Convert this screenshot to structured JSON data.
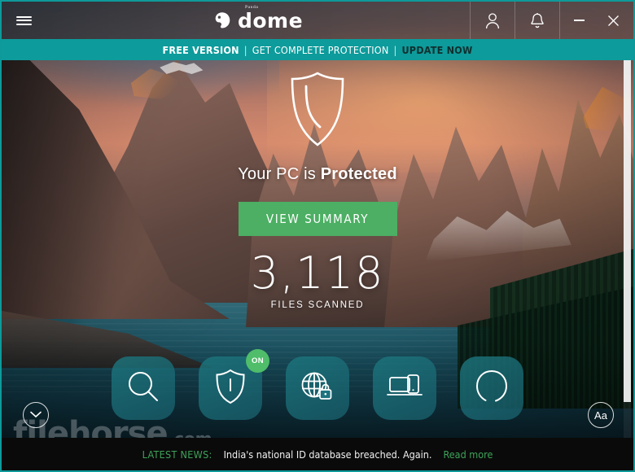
{
  "window": {
    "title": "Panda Dome",
    "brand_sup": "Panda",
    "brand_name": "dome",
    "menu_icon": "hamburger-icon",
    "account_icon": "user-icon",
    "notifications_icon": "bell-icon",
    "minimize_label": "Minimize",
    "close_label": "Close",
    "accent_teal": "#0d9b9b",
    "accent_green": "#4caf63"
  },
  "promo": {
    "version_label": "FREE VERSION",
    "separator": "|",
    "offer_label": "GET COMPLETE PROTECTION",
    "cta_label": "UPDATE NOW"
  },
  "status": {
    "shield_icon": "shield-check-icon",
    "prefix": "Your PC is ",
    "state": "Protected",
    "button_label": "VIEW SUMMARY",
    "files_scanned_count": "3,118",
    "files_scanned_label": "FILES SCANNED"
  },
  "dock": {
    "tiles": [
      {
        "name": "scan",
        "icon": "magnifier-icon",
        "label": "Scan",
        "badge": ""
      },
      {
        "name": "antivirus",
        "icon": "shield-icon",
        "label": "Antivirus",
        "badge": "ON"
      },
      {
        "name": "vpn",
        "icon": "globe-lock-icon",
        "label": "VPN",
        "badge": ""
      },
      {
        "name": "devices",
        "icon": "devices-icon",
        "label": "My Devices",
        "badge": ""
      },
      {
        "name": "optimize",
        "icon": "circular-arc-icon",
        "label": "Optimize",
        "badge": ""
      }
    ]
  },
  "controls": {
    "expand_icon": "chevron-down-icon",
    "text_size_label": "Aa"
  },
  "watermark": {
    "name": "filehorse",
    "suffix": ".com"
  },
  "news": {
    "label": "LATEST NEWS:",
    "headline": "India's national ID database breached. Again.",
    "link_label": "Read more"
  }
}
